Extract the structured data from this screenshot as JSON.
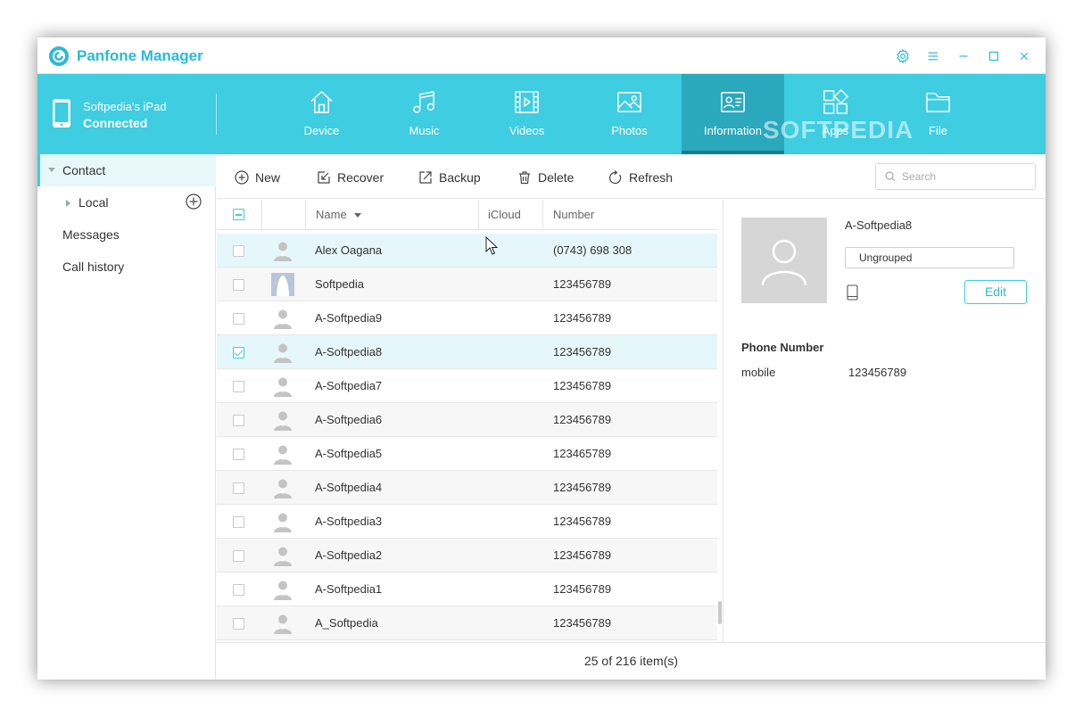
{
  "app": {
    "title": "Panfone Manager",
    "accent_color": "#3ecde1"
  },
  "window_controls": [
    "gear-icon",
    "menu-icon",
    "minimize-icon",
    "maximize-icon",
    "close-icon"
  ],
  "device": {
    "name": "Softpedia's iPad",
    "status": "Connected"
  },
  "nav": {
    "tabs": [
      {
        "label": "Device",
        "icon": "home-icon"
      },
      {
        "label": "Music",
        "icon": "music-icon"
      },
      {
        "label": "Videos",
        "icon": "video-icon"
      },
      {
        "label": "Photos",
        "icon": "photo-icon"
      },
      {
        "label": "Information",
        "icon": "contact-card-icon",
        "active": true
      },
      {
        "label": "Apps",
        "icon": "apps-icon"
      },
      {
        "label": "File",
        "icon": "folder-icon"
      }
    ]
  },
  "watermark": "SOFTPEDIA",
  "sidebar": {
    "contact": "Contact",
    "local": "Local",
    "messages": "Messages",
    "call_history": "Call history"
  },
  "toolbar": {
    "new": "New",
    "recover": "Recover",
    "backup": "Backup",
    "delete": "Delete",
    "refresh": "Refresh",
    "search_placeholder": "Search"
  },
  "table": {
    "columns": {
      "name": "Name",
      "icloud": "iCloud",
      "number": "Number"
    },
    "rows": [
      {
        "name": "Alex Oagana",
        "number": "(0743) 698 308",
        "photo": false
      },
      {
        "name": "Softpedia",
        "number": "123456789",
        "photo": true
      },
      {
        "name": "A-Softpedia9",
        "number": "123456789",
        "photo": false
      },
      {
        "name": "A-Softpedia8",
        "number": "123456789",
        "photo": false,
        "checked": true
      },
      {
        "name": "A-Softpedia7",
        "number": "123456789",
        "photo": false
      },
      {
        "name": "A-Softpedia6",
        "number": "123456789",
        "photo": false
      },
      {
        "name": "A-Softpedia5",
        "number": "123465789",
        "photo": false
      },
      {
        "name": "A-Softpedia4",
        "number": "123456789",
        "photo": false
      },
      {
        "name": "A-Softpedia3",
        "number": "123456789",
        "photo": false
      },
      {
        "name": "A-Softpedia2",
        "number": "123456789",
        "photo": false
      },
      {
        "name": "A-Softpedia1",
        "number": "123456789",
        "photo": false
      },
      {
        "name": "A_Softpedia",
        "number": "123456789",
        "photo": false
      }
    ]
  },
  "footer": {
    "count": "25 of 216 item(s)"
  },
  "detail": {
    "name": "A-Softpedia8",
    "group": "Ungrouped",
    "edit": "Edit",
    "section": "Phone Number",
    "field_label": "mobile",
    "field_value": "123456789"
  }
}
